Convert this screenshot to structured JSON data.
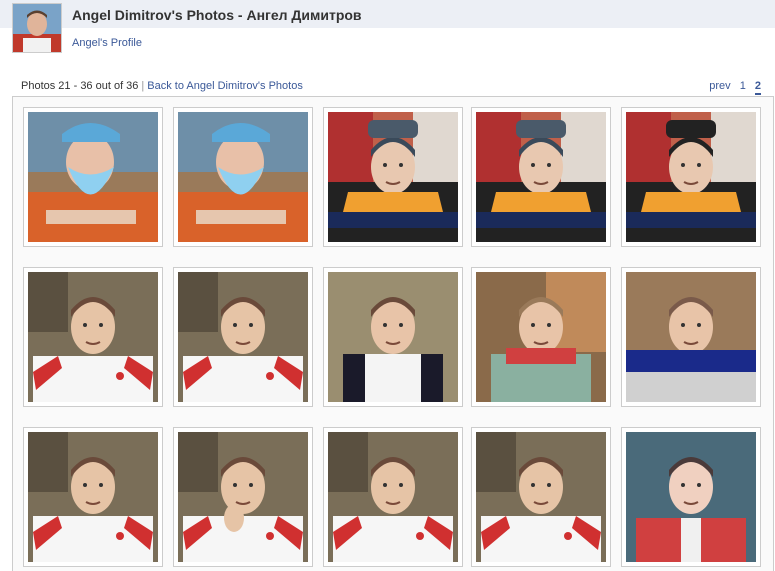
{
  "header": {
    "title": "Angel Dimitrov's Photos - Ангел Димитров",
    "profile_link": "Angel's Profile"
  },
  "subbar": {
    "count_text": "Photos 21 - 36 out of 36",
    "separator": "|",
    "back_link": "Back to Angel Dimitrov's Photos"
  },
  "pager": {
    "prev": "prev",
    "page1": "1",
    "page2": "2"
  },
  "colors": {
    "link": "#3b5998",
    "header_band": "#eceff5",
    "border": "#cccccc"
  },
  "photos": [
    {
      "kind": "santa"
    },
    {
      "kind": "santa"
    },
    {
      "kind": "cap-scarf"
    },
    {
      "kind": "cap-scarf"
    },
    {
      "kind": "hood-scarf"
    },
    {
      "kind": "white-jersey"
    },
    {
      "kind": "white-jersey"
    },
    {
      "kind": "polo"
    },
    {
      "kind": "green-scarf"
    },
    {
      "kind": "blue-scarf"
    },
    {
      "kind": "white-jersey"
    },
    {
      "kind": "hand-chin"
    },
    {
      "kind": "white-jersey"
    },
    {
      "kind": "white-jersey"
    },
    {
      "kind": "red-jacket"
    }
  ]
}
